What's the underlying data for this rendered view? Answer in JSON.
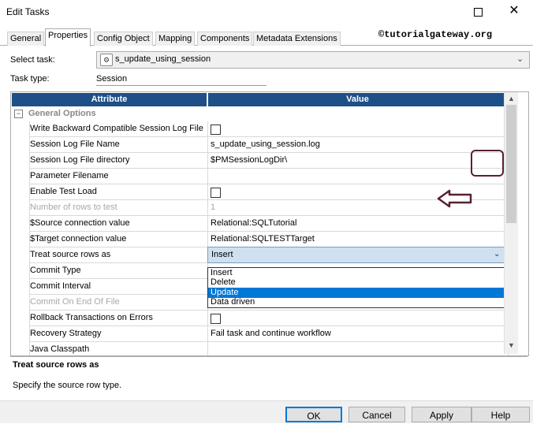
{
  "window": {
    "title": "Edit Tasks"
  },
  "tabs": [
    "General",
    "Properties",
    "Config Object",
    "Mapping",
    "Components",
    "Metadata Extensions"
  ],
  "watermark": "©tutorialgateway.org",
  "task": {
    "select_label": "Select task:",
    "selected_task": "s_update_using_session",
    "type_label": "Task type:",
    "type_value": "Session"
  },
  "grid": {
    "columns": [
      "Attribute",
      "Value"
    ],
    "group": "General Options",
    "rows": [
      {
        "attribute": "Write Backward Compatible Session Log File",
        "value": "",
        "kind": "checkbox"
      },
      {
        "attribute": "Session Log File Name",
        "value": "s_update_using_session.log",
        "kind": "text"
      },
      {
        "attribute": "Session Log File directory",
        "value": "$PMSessionLogDir\\",
        "kind": "text"
      },
      {
        "attribute": "Parameter Filename",
        "value": "",
        "kind": "text"
      },
      {
        "attribute": "Enable Test Load",
        "value": "",
        "kind": "checkbox"
      },
      {
        "attribute": "Number of rows to test",
        "value": "1",
        "kind": "disabled"
      },
      {
        "attribute": "$Source connection value",
        "value": "Relational:SQLTutorial",
        "kind": "text"
      },
      {
        "attribute": "$Target connection value",
        "value": "Relational:SQLTESTTarget",
        "kind": "text"
      },
      {
        "attribute": "Treat source rows as",
        "value": "Insert",
        "kind": "combo"
      },
      {
        "attribute": "Commit Type",
        "value": "",
        "kind": "text"
      },
      {
        "attribute": "Commit Interval",
        "value": "",
        "kind": "text"
      },
      {
        "attribute": "Commit On End Of File",
        "value": "",
        "kind": "disabled"
      },
      {
        "attribute": "Rollback Transactions on Errors",
        "value": "",
        "kind": "checkbox"
      },
      {
        "attribute": "Recovery Strategy",
        "value": "Fail task and continue workflow",
        "kind": "text"
      },
      {
        "attribute": "Java Classpath",
        "value": "",
        "kind": "text"
      }
    ],
    "dropdown_options": [
      "Insert",
      "Delete",
      "Update",
      "Data driven"
    ],
    "dropdown_selected": "Update"
  },
  "description": {
    "title": "Treat source rows as",
    "text": "Specify the source row type."
  },
  "buttons": {
    "ok": "OK",
    "cancel": "Cancel",
    "apply": "Apply",
    "help": "Help"
  },
  "colors": {
    "header_bg": "#1e4f86",
    "selection": "#0078d7",
    "highlight_border": "#5a2130"
  }
}
